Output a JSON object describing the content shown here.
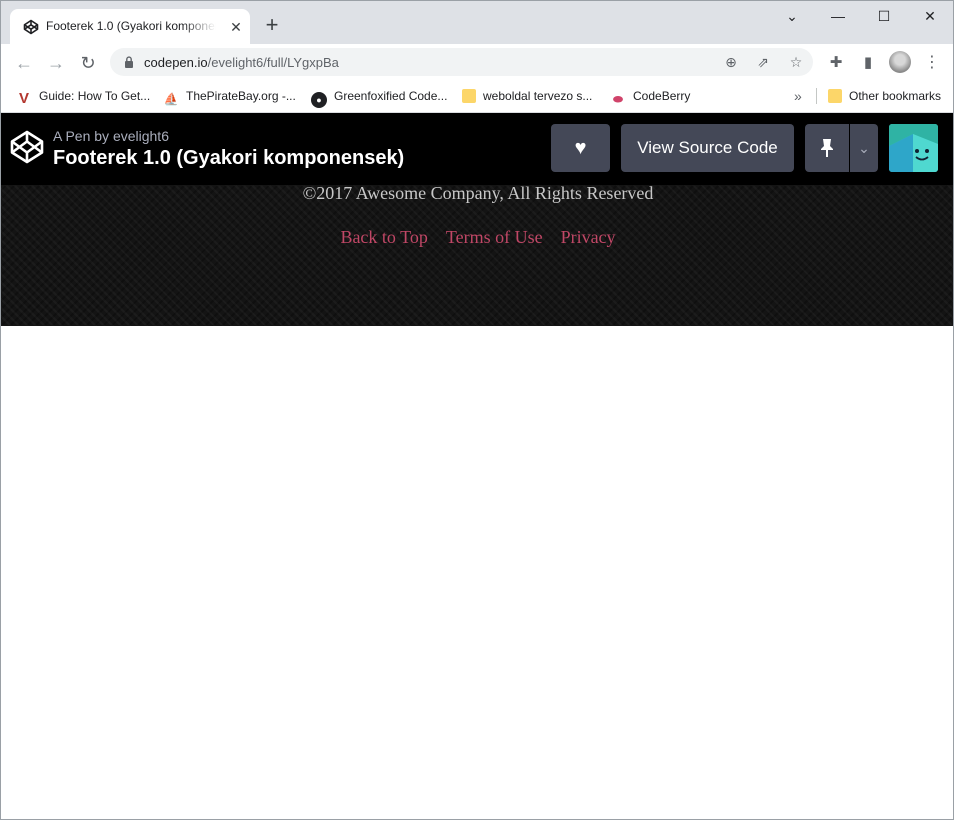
{
  "browser": {
    "tab": {
      "title": "Footerek 1.0 (Gyakori komponensek)"
    },
    "new_tab_label": "+",
    "window_controls": {
      "tab_search": "⌄",
      "minimize": "—",
      "maximize": "☐",
      "close": "✕"
    },
    "address_bar": {
      "host": "codepen.io",
      "path": "/evelight6/full/LYgxpBa"
    },
    "bookmarks": [
      {
        "label": "Guide: How To Get...",
        "icon": "vivaldi-v-icon"
      },
      {
        "label": "ThePirateBay.org -...",
        "icon": "pirate-ship-icon"
      },
      {
        "label": "Greenfoxified Code...",
        "icon": "github-icon"
      },
      {
        "label": "weboldal tervezo s...",
        "icon": "folder-icon"
      },
      {
        "label": "CodeBerry",
        "icon": "codeberry-icon"
      }
    ],
    "bookmarks_overflow": "»",
    "other_bookmarks": "Other bookmarks"
  },
  "codepen": {
    "author_prefix": "A Pen by",
    "author_name": "evelight6",
    "pen_title": "Footerek 1.0 (Gyakori komponensek)",
    "view_source_label": "View Source Code"
  },
  "footer": {
    "copyright": "©2017 Awesome Company, All Rights Reserved",
    "links": [
      "Back to Top",
      "Terms of Use",
      "Privacy"
    ],
    "colors": {
      "link": "#c04766",
      "background": "#141414",
      "text": "#c8c8c8"
    }
  }
}
